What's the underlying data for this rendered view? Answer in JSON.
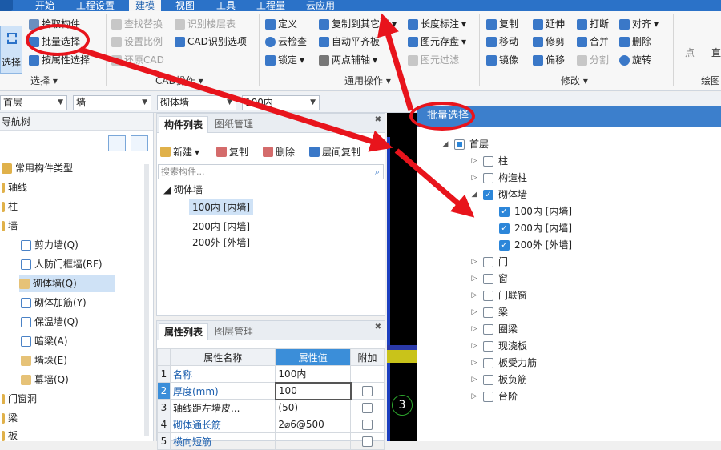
{
  "menu": {
    "items": [
      "开始",
      "工程设置",
      "建模",
      "视图",
      "工具",
      "工程量",
      "云应用"
    ],
    "active": "建模"
  },
  "ribbon": {
    "select_group": {
      "big_button": "选择",
      "items": [
        "拾取构件",
        "批量选择",
        "按属性选择"
      ],
      "label": "选择"
    },
    "cad_group": {
      "items": [
        "查找替换",
        "识别楼层表",
        "设置比例",
        "CAD识别选项",
        "还原CAD"
      ],
      "label": "CAD操作"
    },
    "common_group": {
      "items": [
        "定义",
        "复制到其它层",
        "长度标注",
        "云检查",
        "自动平齐板",
        "图元存盘",
        "锁定",
        "两点辅轴",
        "图元过滤"
      ],
      "label": "通用操作"
    },
    "modify_group": {
      "items": [
        "复制",
        "延伸",
        "打断",
        "对齐",
        "移动",
        "修剪",
        "合并",
        "删除",
        "镜像",
        "偏移",
        "分割",
        "旋转"
      ],
      "label": "修改"
    },
    "draw_group": {
      "items": [
        "点",
        "直"
      ],
      "label": "绘图"
    }
  },
  "filters": [
    "首层",
    "墙",
    "砌体墙",
    "100内"
  ],
  "nav": {
    "title": "导航树",
    "items": [
      "常用构件类型",
      "轴线",
      "柱",
      "墙",
      "剪力墙(Q)",
      "人防门框墙(RF)",
      "砌体墙(Q)",
      "砌体加筋(Y)",
      "保温墙(Q)",
      "暗梁(A)",
      "墙垛(E)",
      "幕墙(Q)",
      "门窗洞",
      "梁",
      "板"
    ],
    "selected": "砌体墙(Q)"
  },
  "component_list": {
    "tabs": [
      "构件列表",
      "图纸管理"
    ],
    "toolbar": [
      "新建",
      "复制",
      "删除",
      "层间复制"
    ],
    "search_placeholder": "搜索构件...",
    "tree": {
      "group": "砌体墙",
      "items": [
        "100内 [内墙]",
        "200内 [内墙]",
        "200外 [外墙]"
      ],
      "selected": "100内 [内墙]"
    }
  },
  "property_list": {
    "tabs": [
      "属性列表",
      "图层管理"
    ],
    "columns": [
      "属性名称",
      "属性值",
      "附加"
    ],
    "rows": [
      {
        "no": "1",
        "name": "名称",
        "value": "100内"
      },
      {
        "no": "2",
        "name": "厚度(mm)",
        "value": "100"
      },
      {
        "no": "3",
        "name": "轴线距左墙皮...",
        "value": "(50)"
      },
      {
        "no": "4",
        "name": "砌体通长筋",
        "value": "2⌀6@500"
      },
      {
        "no": "5",
        "name": "横向短筋",
        "value": ""
      }
    ]
  },
  "canvas": {
    "axis_label": "3"
  },
  "dialog": {
    "title": "批量选择",
    "tree": [
      {
        "label": "首层",
        "check": "partial"
      },
      {
        "label": "柱",
        "check": "off"
      },
      {
        "label": "构造柱",
        "check": "off"
      },
      {
        "label": "砌体墙",
        "check": "on"
      },
      {
        "label": "100内 [内墙]",
        "check": "on"
      },
      {
        "label": "200内 [内墙]",
        "check": "on"
      },
      {
        "label": "200外 [外墙]",
        "check": "on"
      },
      {
        "label": "门",
        "check": "off"
      },
      {
        "label": "窗",
        "check": "off"
      },
      {
        "label": "门联窗",
        "check": "off"
      },
      {
        "label": "梁",
        "check": "off"
      },
      {
        "label": "圈梁",
        "check": "off"
      },
      {
        "label": "现浇板",
        "check": "off"
      },
      {
        "label": "板受力筋",
        "check": "off"
      },
      {
        "label": "板负筋",
        "check": "off"
      },
      {
        "label": "台阶",
        "check": "off"
      }
    ]
  },
  "colors": {
    "accent": "#2b72c8",
    "dialog_title": "#3c7fcc",
    "annotation": "#e8141c",
    "selection": "#cfe2f6"
  }
}
